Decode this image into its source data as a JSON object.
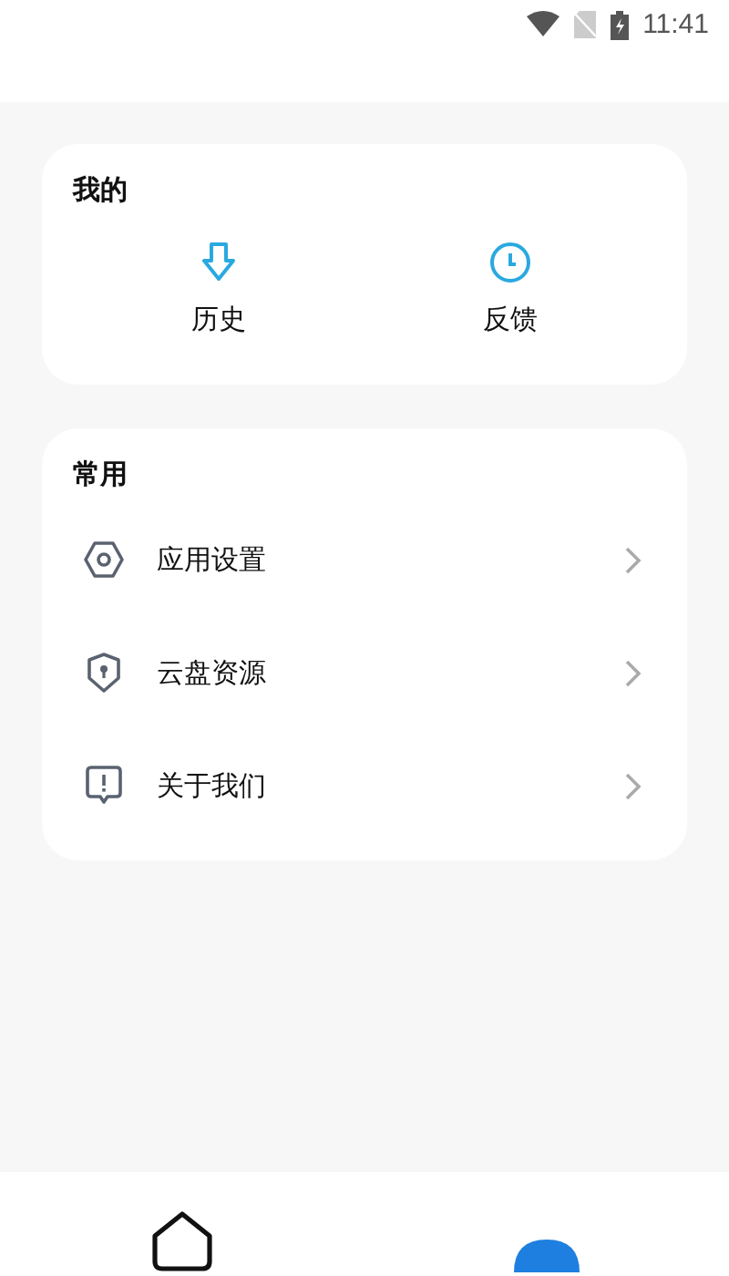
{
  "status_bar": {
    "time": "11:41"
  },
  "mine": {
    "title": "我的",
    "items": [
      {
        "label": "历史",
        "kind": "download"
      },
      {
        "label": "反馈",
        "kind": "clock"
      }
    ]
  },
  "common": {
    "title": "常用",
    "items": [
      {
        "label": "应用设置",
        "kind": "settings"
      },
      {
        "label": "云盘资源",
        "kind": "shield"
      },
      {
        "label": "关于我们",
        "kind": "alert"
      }
    ]
  },
  "bottom_nav": {
    "tabs": [
      {
        "kind": "home",
        "selected": false
      },
      {
        "kind": "profile",
        "selected": true
      }
    ]
  }
}
